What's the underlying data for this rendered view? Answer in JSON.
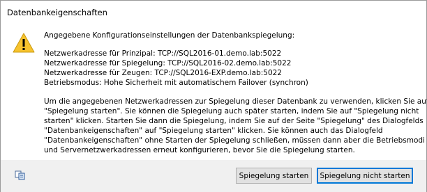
{
  "window": {
    "title": "Datenbankeigenschaften"
  },
  "message": {
    "intro": "Angegebene Konfigurationseinstellungen der Datenbankspiegelung:",
    "details": [
      "Netzwerkadresse für Prinzipal: TCP://SQL2016-01.demo.lab:5022",
      "Netzwerkadresse für Spiegelung: TCP://SQL2016-02.demo.lab:5022",
      "Netzwerkadresse für Zeugen: TCP://SQL2016-EXP.demo.lab:5022",
      "Betriebsmodus: Hohe Sicherheit mit automatischem Failover (synchron)"
    ],
    "info": [
      "Um die angegebenen Netzwerkadressen zur Spiegelung dieser Datenbank zu verwenden, klicken Sie auf",
      "\"Spiegelung starten\". Sie können die Spiegelung auch später starten, indem Sie auf \"Spiegelung nicht",
      "starten\" klicken. Starten Sie dann die Spiegelung, indem Sie auf der Seite \"Spiegelung\" des Dialogfelds",
      "\"Datenbankeigenschaften\" auf \"Spiegelung starten\" klicken. Sie können auch das Dialogfeld",
      "\"Datenbankeigenschaften\" ohne Starten der Spiegelung schließen, müssen dann aber die Betriebsmodi",
      "und Servernetzwerkadressen erneut konfigurieren, bevor Sie die Spiegelung starten."
    ]
  },
  "icons": {
    "message": "warning-icon",
    "footer": "copy-icon"
  },
  "buttons": {
    "start": "Spiegelung starten",
    "no_start": "Spiegelung nicht starten"
  },
  "colors": {
    "warning_fill": "#f7c32e",
    "focus_border": "#0078d7",
    "footer_bg": "#f0f0f0"
  }
}
